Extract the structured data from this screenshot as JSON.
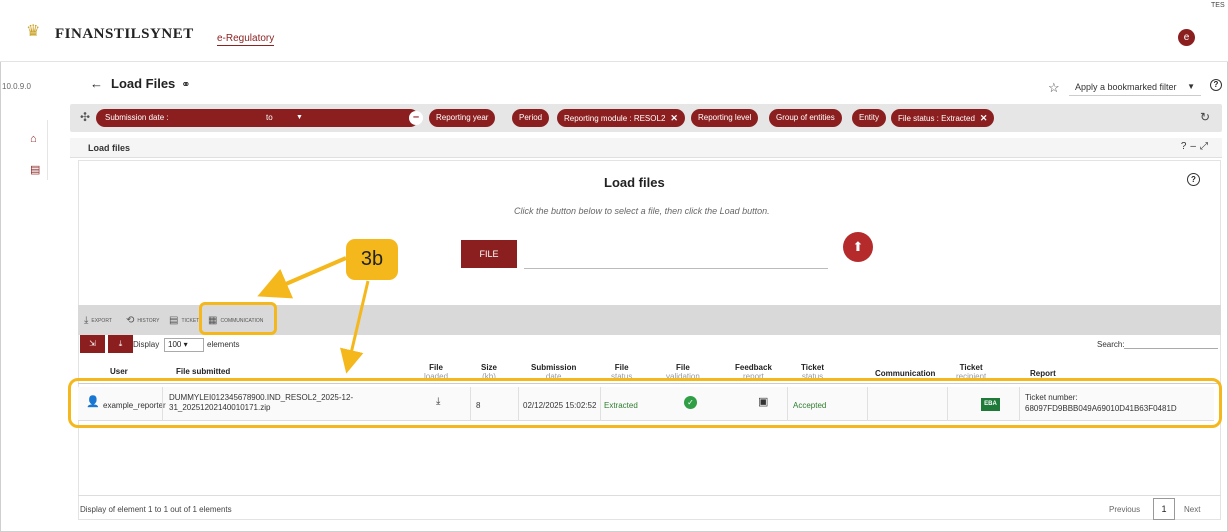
{
  "header": {
    "brand": "FINANSTILSYNET",
    "app_name": "e-Regulatory",
    "user_initial": "e",
    "corner_text": "TES"
  },
  "version": "10.0.9.0",
  "page": {
    "back_glyph": "←",
    "title": "Load Files",
    "link_glyph": "⊖"
  },
  "bookmark": {
    "label": "Apply a bookmarked filter",
    "star": "☆"
  },
  "filters": {
    "date_label": "Submission date :",
    "to_label": "to",
    "chips": [
      {
        "label": "Reporting year"
      },
      {
        "label": "Period"
      },
      {
        "label": "Reporting module : RESOL2",
        "removable": true
      },
      {
        "label": "Reporting level"
      },
      {
        "label": "Group of entities"
      },
      {
        "label": "Entity"
      },
      {
        "label": "File status : Extracted",
        "removable": true
      }
    ]
  },
  "section": {
    "title": "Load files"
  },
  "load_files": {
    "title": "Load files",
    "description": "Click the button below to select a file, then click the Load button.",
    "file_button": "FILE"
  },
  "toolbar": {
    "export": "EXPORT",
    "history": "HISTORY",
    "ticket": "TICKET",
    "communication": "COMMUNICATION"
  },
  "table": {
    "display_label": "Display",
    "page_size": "100",
    "elements_label": "elements",
    "search_label": "Search:",
    "columns": [
      {
        "label": "User",
        "sub": ""
      },
      {
        "label": "File submitted",
        "sub": ""
      },
      {
        "label": "File",
        "sub": "loaded"
      },
      {
        "label": "Size",
        "sub": "(kb)"
      },
      {
        "label": "Submission",
        "sub": "date"
      },
      {
        "label": "File",
        "sub": "status"
      },
      {
        "label": "File",
        "sub": "validation"
      },
      {
        "label": "Feedback",
        "sub": "report"
      },
      {
        "label": "Ticket",
        "sub": "status"
      },
      {
        "label": "Communication",
        "sub": ""
      },
      {
        "label": "Ticket",
        "sub": "recipient"
      },
      {
        "label": "Report",
        "sub": ""
      }
    ],
    "rows": [
      {
        "user": "example_reporter",
        "file_submitted": "DUMMYLEI012345678900.IND_RESOL2_2025-12-31_20251202140010171.zip",
        "size": "8",
        "submission_date": "02/12/2025 15:02:52",
        "file_status": "Extracted",
        "ticket_status": "Accepted",
        "ticket_recipient": "EBA",
        "report_label": "Ticket number:",
        "report_value": "68097FD9BBB049A69010D41B63F0481D"
      }
    ],
    "footer": "Display of element 1 to 1 out of 1 elements",
    "pagination": {
      "previous": "Previous",
      "current": "1",
      "next": "Next"
    }
  },
  "annotation": {
    "label": "3b",
    "color": "#f5b81c"
  }
}
